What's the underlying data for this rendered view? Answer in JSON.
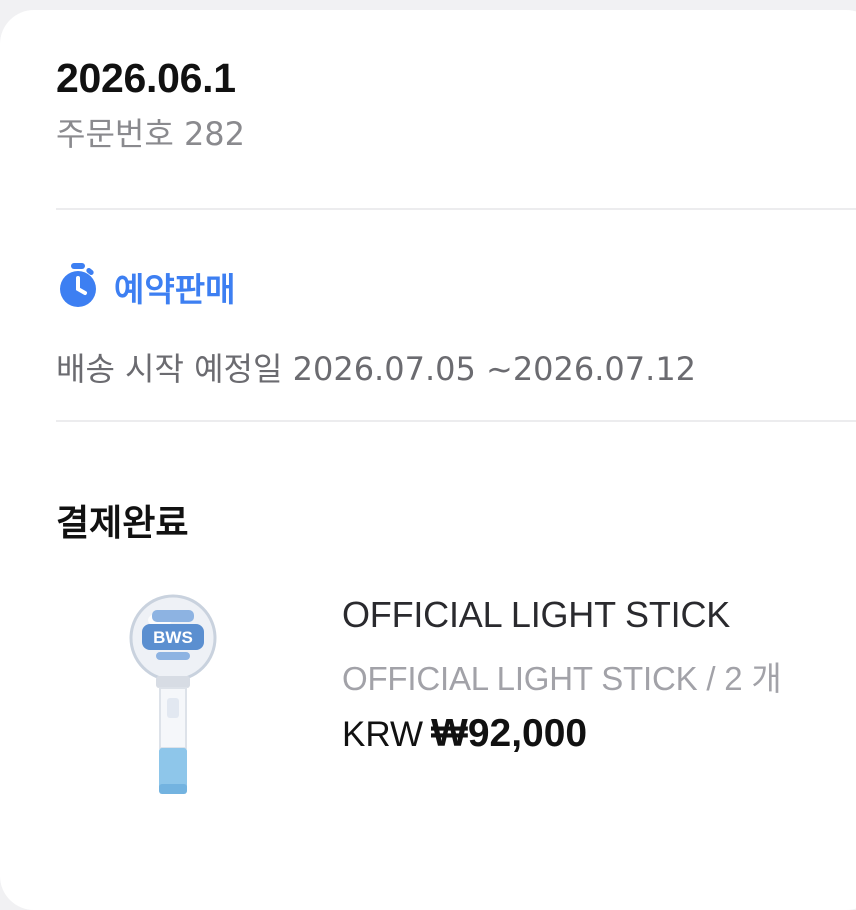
{
  "order": {
    "date": "2026.06.1",
    "number_label": "주문번호",
    "number": "282"
  },
  "reservation": {
    "label": "예약판매",
    "icon": "stopwatch-icon",
    "ship_label": "배송 시작 예정일",
    "ship_range": "2026.07.05 ~2026.07.12"
  },
  "payment": {
    "status": "결제완료"
  },
  "product": {
    "name": "OFFICIAL LIGHT STICK",
    "option": "OFFICIAL LIGHT STICK / 2 개",
    "currency": "KRW",
    "price": "₩92,000",
    "image_text": "BWS"
  },
  "colors": {
    "accent": "#3d7ff2",
    "stick_blue": "#8ec6ea"
  }
}
